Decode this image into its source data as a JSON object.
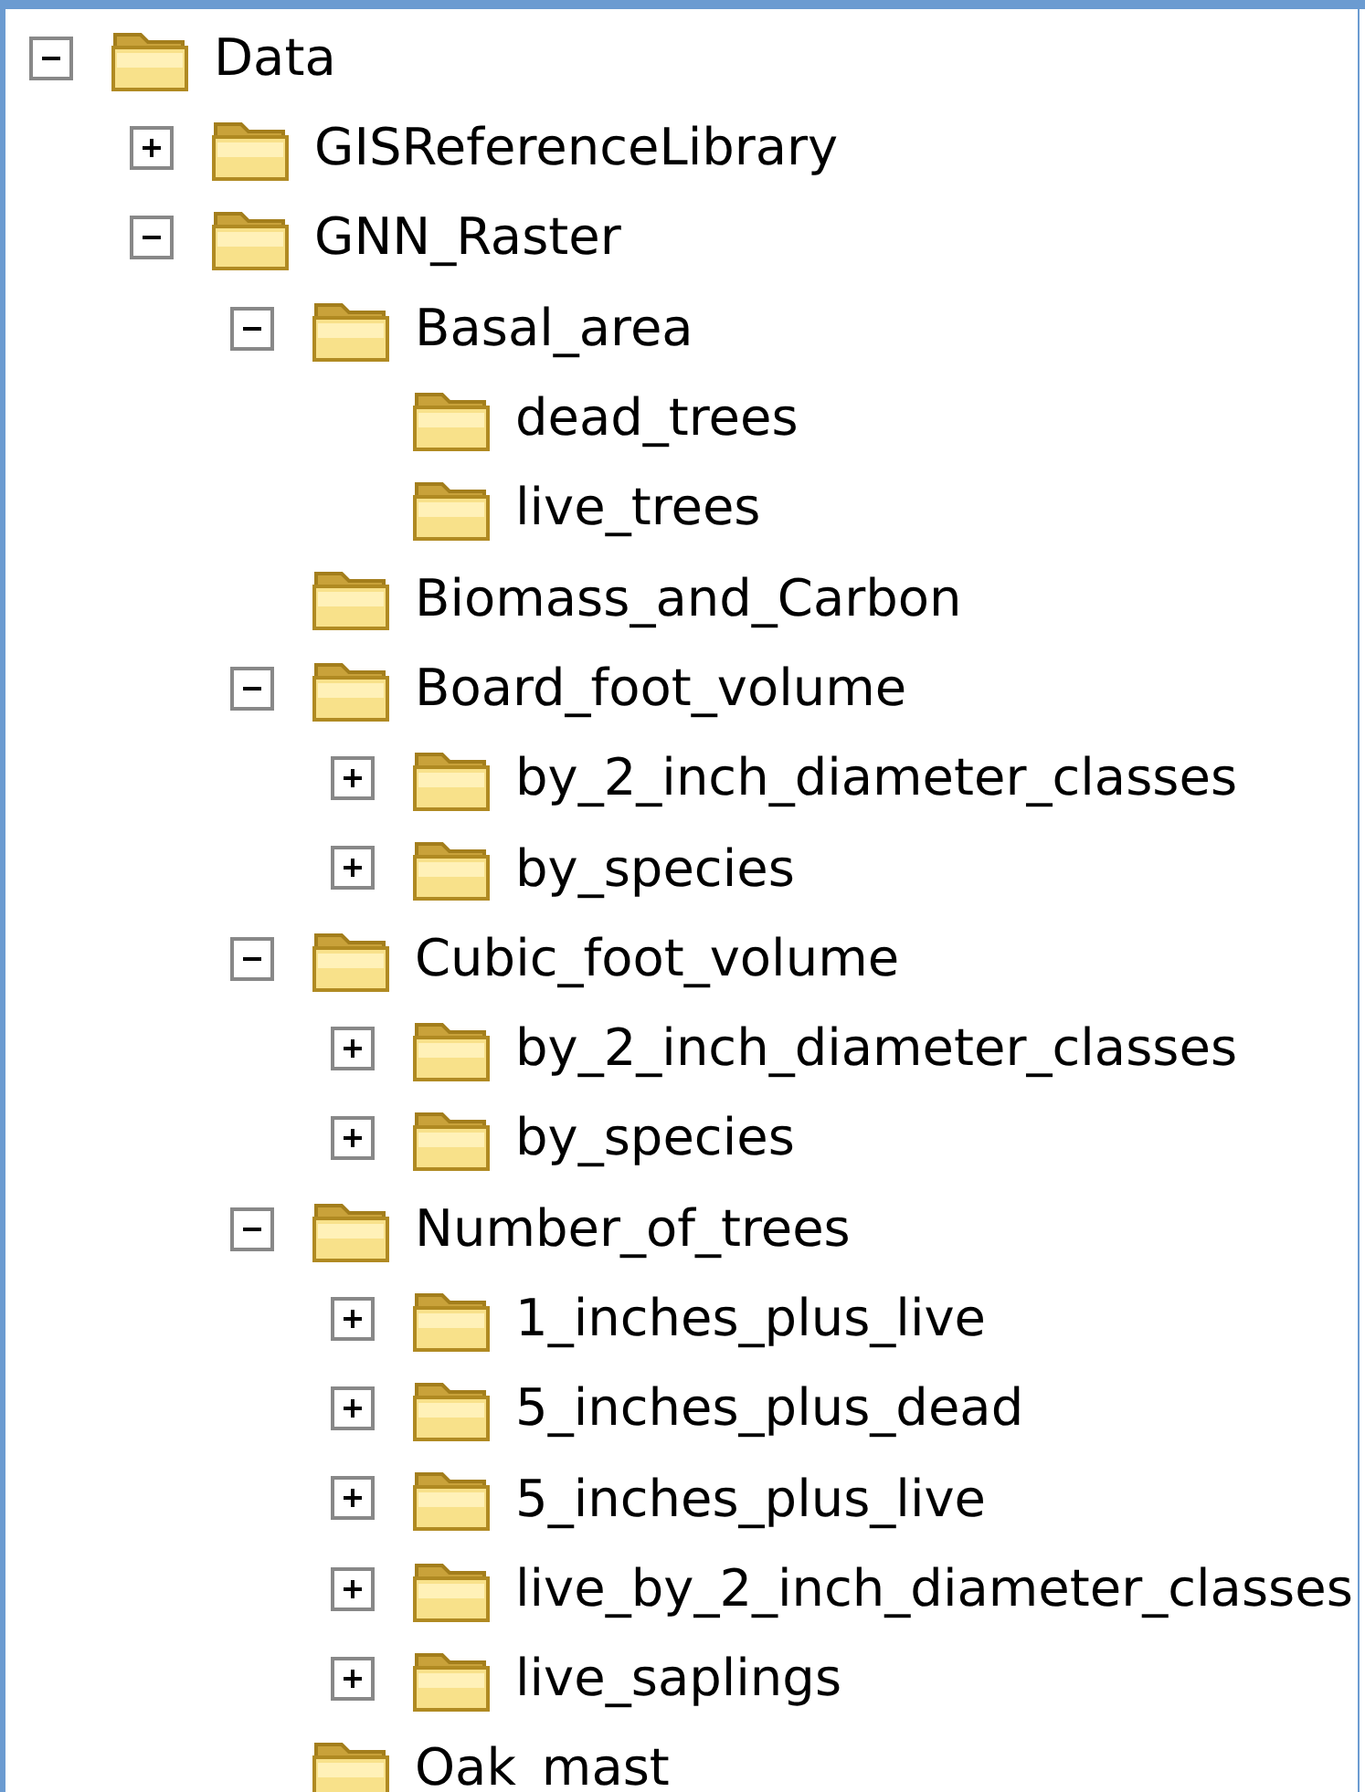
{
  "tree": [
    {
      "label": "Data",
      "kind": "branch",
      "expanded": true,
      "children": [
        {
          "label": "GISReferenceLibrary",
          "kind": "branch",
          "expanded": false
        },
        {
          "label": "GNN_Raster",
          "kind": "branch",
          "expanded": true,
          "children": [
            {
              "label": "Basal_area",
              "kind": "branch",
              "expanded": true,
              "children": [
                {
                  "label": "dead_trees",
                  "kind": "leaf"
                },
                {
                  "label": "live_trees",
                  "kind": "leaf"
                }
              ]
            },
            {
              "label": "Biomass_and_Carbon",
              "kind": "leaf"
            },
            {
              "label": "Board_foot_volume",
              "kind": "branch",
              "expanded": true,
              "children": [
                {
                  "label": "by_2_inch_diameter_classes",
                  "kind": "branch",
                  "expanded": false
                },
                {
                  "label": "by_species",
                  "kind": "branch",
                  "expanded": false
                }
              ]
            },
            {
              "label": "Cubic_foot_volume",
              "kind": "branch",
              "expanded": true,
              "children": [
                {
                  "label": "by_2_inch_diameter_classes",
                  "kind": "branch",
                  "expanded": false
                },
                {
                  "label": "by_species",
                  "kind": "branch",
                  "expanded": false
                }
              ]
            },
            {
              "label": "Number_of_trees",
              "kind": "branch",
              "expanded": true,
              "children": [
                {
                  "label": "1_inches_plus_live",
                  "kind": "branch",
                  "expanded": false
                },
                {
                  "label": "5_inches_plus_dead",
                  "kind": "branch",
                  "expanded": false
                },
                {
                  "label": "5_inches_plus_live",
                  "kind": "branch",
                  "expanded": false
                },
                {
                  "label": "live_by_2_inch_diameter_classes",
                  "kind": "branch",
                  "expanded": false
                },
                {
                  "label": "live_saplings",
                  "kind": "branch",
                  "expanded": false
                }
              ]
            },
            {
              "label": "Oak_mast",
              "kind": "leaf"
            }
          ]
        }
      ]
    }
  ]
}
